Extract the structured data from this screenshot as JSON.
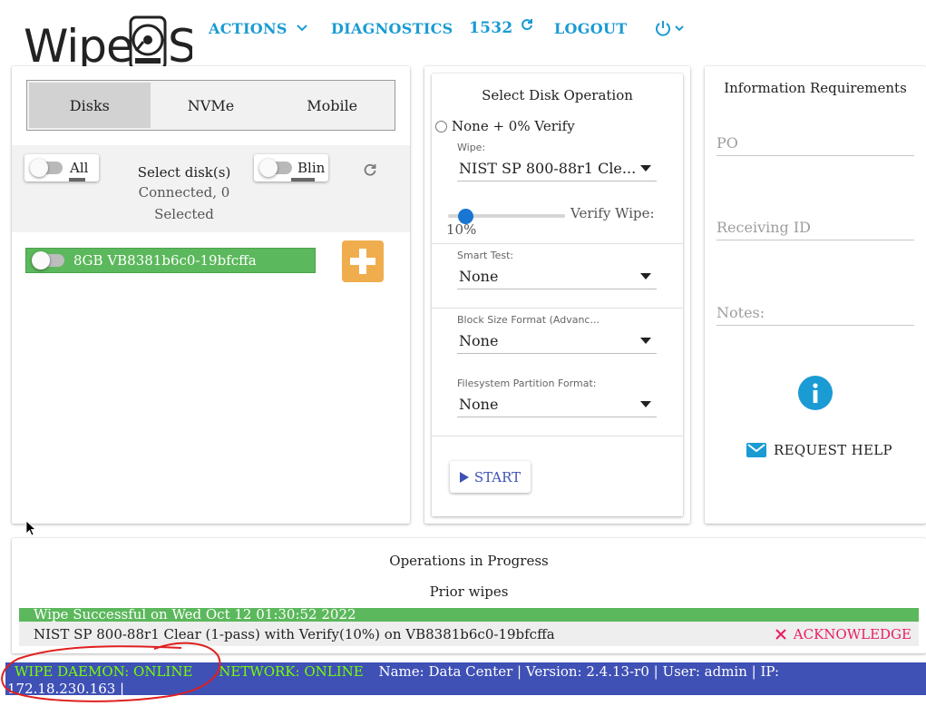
{
  "header": {
    "logo_text": "WipeOS",
    "nav": {
      "actions": "ACTIONS",
      "diagnostics": "DIAGNOSTICS",
      "count": "1532",
      "logout": "LOGOUT"
    }
  },
  "disks_panel": {
    "tabs": [
      "Disks",
      "NVMe",
      "Mobile"
    ],
    "active_tab": "Disks",
    "all_toggle": "All",
    "blink_toggle": "Blin",
    "select_title": "Select disk(s)",
    "connected_line": "Connected, 0",
    "selected_line": "Selected",
    "disks": [
      {
        "label": "8GB VB8381b6c0-19bfcffa",
        "color": "#5cb85c"
      }
    ]
  },
  "operation_panel": {
    "title": "Select Disk Operation",
    "radio_label": "None + 0% Verify",
    "wipe_label": "Wipe:",
    "wipe_value": "NIST SP 800-88r1 Cle...",
    "verify_label": "Verify Wipe:",
    "verify_value": "10%",
    "verify_fraction": 0.1,
    "smart_label": "Smart Test:",
    "smart_value": "None",
    "block_label": "Block Size Format (Advanc...",
    "block_value": "None",
    "fs_label": "Filesystem Partition Format:",
    "fs_value": "None",
    "start_button": "START"
  },
  "info_panel": {
    "title": "Information Requirements",
    "po_placeholder": "PO",
    "receiving_placeholder": "Receiving ID",
    "notes_placeholder": "Notes:",
    "help_button": "REQUEST HELP"
  },
  "operations": {
    "title": "Operations in Progress",
    "prior_title": "Prior wipes",
    "prior": [
      {
        "status": "Wipe Successful on Wed Oct 12 01:30:52 2022",
        "detail": "NIST SP 800-88r1 Clear (1-pass) with Verify(10%) on VB8381b6c0-19bfcffa",
        "ack": "ACKNOWLEDGE"
      }
    ]
  },
  "status_bar": {
    "daemon": "WIPE DAEMON: ONLINE",
    "network": "NETWORK: ONLINE",
    "info": "Name: Data Center | Version: 2.4.13-r0 | User: admin | IP:",
    "ip_line": "172.18.230.163 |"
  },
  "colors": {
    "accent": "#1a9bd3",
    "success": "#5cb85c",
    "warning": "#f0ad4e",
    "status_bar": "#3f51b5",
    "online": "#76ff03",
    "ack": "#e91e63",
    "slider": "#1976d2"
  }
}
